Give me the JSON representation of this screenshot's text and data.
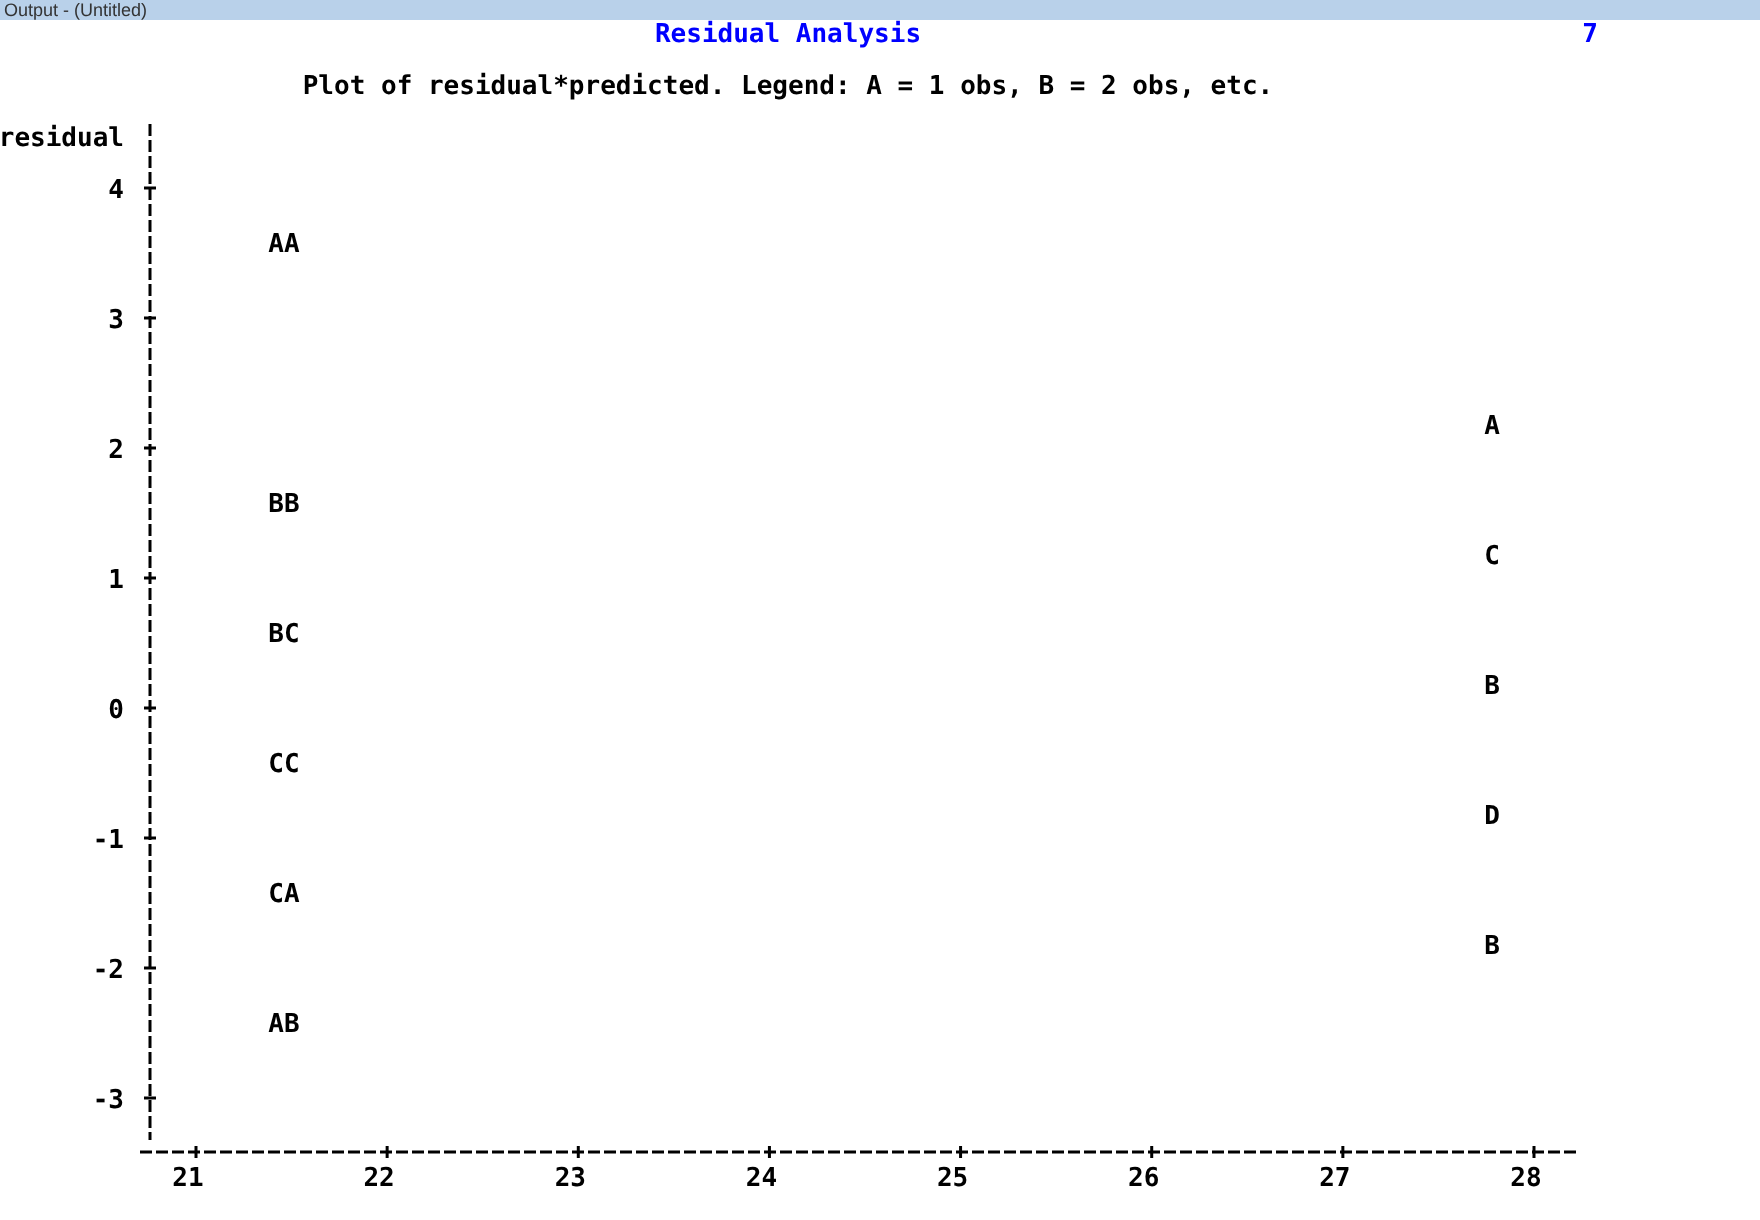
{
  "window": {
    "title": "Output - (Untitled)"
  },
  "page": {
    "title": "Residual Analysis",
    "number": "7",
    "subtitle": "Plot of residual*predicted.  Legend: A = 1 obs, B = 2 obs, etc."
  },
  "plot": {
    "y_label": "residual",
    "rows": [
      {
        "tick": "4",
        "left": "AA"
      },
      {
        "tick": "3",
        "right": "A"
      },
      {
        "tick": "2",
        "left": "BB",
        "right": "C"
      },
      {
        "tick": "1",
        "left": "BC",
        "right": "B"
      },
      {
        "tick": "0",
        "left": "CC",
        "right": "D"
      },
      {
        "tick": "-1",
        "left": "CA",
        "right": "B"
      },
      {
        "tick": "-2",
        "left": "AB"
      },
      {
        "tick": "-3"
      }
    ],
    "x_ticks": [
      "21",
      "22",
      "23",
      "24",
      "25",
      "26",
      "27",
      "28"
    ]
  }
}
